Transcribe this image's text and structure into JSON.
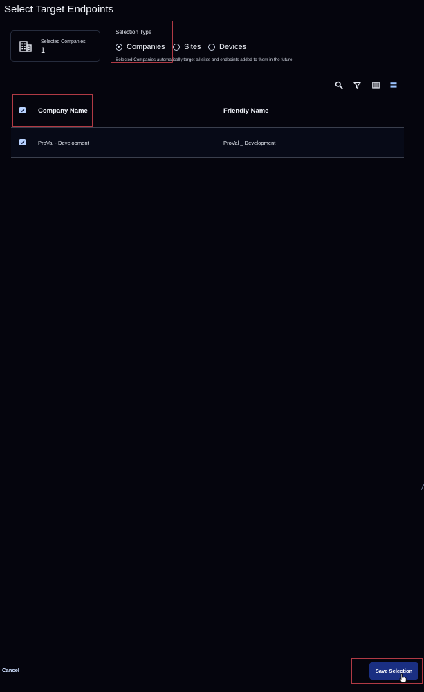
{
  "dialog": {
    "title": "Select Target Endpoints"
  },
  "selected_card": {
    "label": "Selected Companies",
    "count": "1",
    "icon": "building-icon"
  },
  "selection_type": {
    "label": "Selection Type",
    "options": [
      {
        "label": "Companies",
        "selected": true
      },
      {
        "label": "Sites",
        "selected": false
      },
      {
        "label": "Devices",
        "selected": false
      }
    ],
    "hint": "Selected Companies automatically target all sites and endpoints added to them in the future."
  },
  "toolbar": {
    "icons": [
      "search-icon",
      "filter-icon",
      "columns-icon",
      "density-icon"
    ]
  },
  "table": {
    "columns": [
      "Company Name",
      "Friendly Name"
    ],
    "header_checked": true,
    "rows": [
      {
        "checked": true,
        "company_name": "ProVal - Development",
        "friendly_name": "ProVal _ Development"
      }
    ]
  },
  "footer": {
    "cancel_label": "Cancel",
    "save_label": "Save Selection"
  },
  "colors": {
    "background": "#05050d",
    "accent": "#1a2f82",
    "checkbox": "#b9d3ff",
    "highlight_outline": "#b03a44"
  }
}
